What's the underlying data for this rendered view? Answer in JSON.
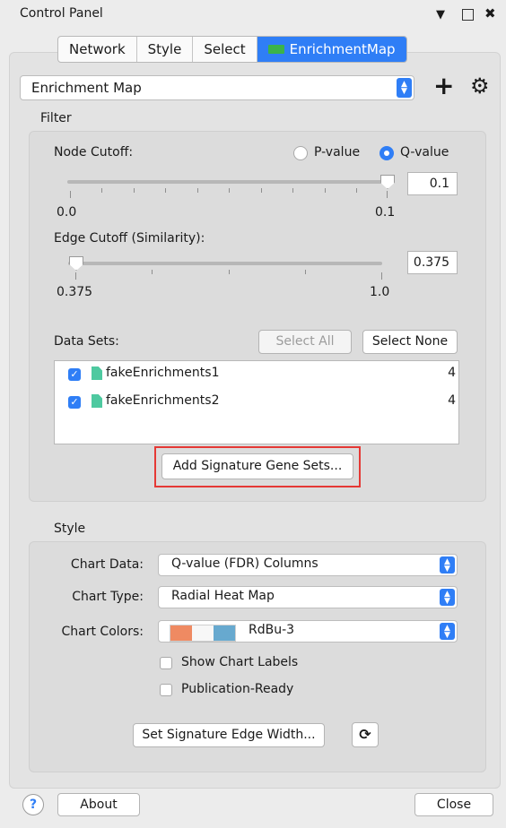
{
  "window": {
    "title": "Control Panel"
  },
  "tabs": [
    {
      "label": "Network"
    },
    {
      "label": "Style"
    },
    {
      "label": "Select"
    },
    {
      "label": "EnrichmentMap",
      "active": true
    }
  ],
  "top_select": {
    "value": "Enrichment Map"
  },
  "filter": {
    "section_title": "Filter",
    "node_cutoff": {
      "label": "Node Cutoff:",
      "radio_pvalue": "P-value",
      "radio_qvalue": "Q-value",
      "selected": "Q-value",
      "value": "0.1",
      "min_label": "0.0",
      "max_label": "0.1",
      "slider_fraction": 1.0
    },
    "edge_cutoff": {
      "label": "Edge Cutoff (Similarity):",
      "value": "0.375",
      "min_label": "0.375",
      "max_label": "1.0",
      "slider_fraction": 0.0
    },
    "datasets": {
      "label": "Data Sets:",
      "select_all": "Select All",
      "select_none": "Select None",
      "items": [
        {
          "name": "fakeEnrichments1",
          "count": "4",
          "checked": true
        },
        {
          "name": "fakeEnrichments2",
          "count": "4",
          "checked": true
        }
      ]
    },
    "add_signature": "Add Signature Gene Sets..."
  },
  "style": {
    "section_title": "Style",
    "chart_data": {
      "label": "Chart Data:",
      "value": "Q-value (FDR) Columns"
    },
    "chart_type": {
      "label": "Chart Type:",
      "value": "Radial Heat Map"
    },
    "chart_colors": {
      "label": "Chart Colors:",
      "value": "RdBu-3",
      "swatches": [
        "#ef8a62",
        "#f7f7f7",
        "#67a9cf"
      ]
    },
    "show_labels": {
      "label": "Show Chart Labels",
      "checked": false
    },
    "publication_ready": {
      "label": "Publication-Ready",
      "checked": false
    },
    "set_edge_width": "Set Signature Edge Width..."
  },
  "footer": {
    "about": "About",
    "close": "Close",
    "help": "?"
  },
  "colors": {
    "accent": "#2f7ef6",
    "highlight": "#e53935",
    "file_icon": "#4ec9a0"
  }
}
